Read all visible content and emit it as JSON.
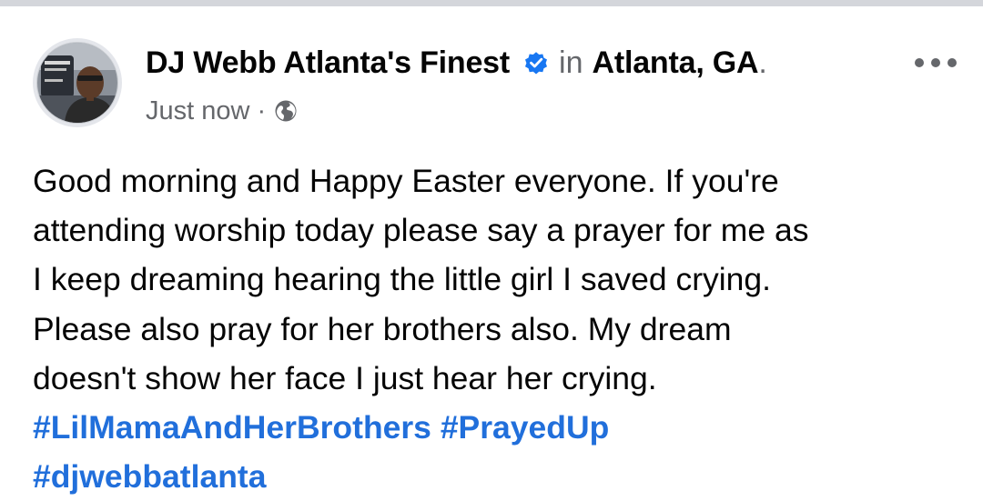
{
  "post": {
    "author": {
      "name": "DJ Webb Atlanta's Finest",
      "verified_icon": "verified-badge-icon"
    },
    "location_prefix": "in",
    "location": "Atlanta, GA",
    "location_suffix": ".",
    "timestamp": "Just now",
    "separator": "·",
    "audience_icon": "globe-icon",
    "more_options_icon": "more-horizontal-icon",
    "body_lines": [
      "Good morning and Happy Easter everyone. If you're",
      "attending worship today please say a prayer for me as",
      "I keep dreaming hearing the little girl I saved crying.",
      "Please also pray for her brothers also. My dream",
      "doesn't show her face I just hear her crying."
    ],
    "hashtags": [
      "#LilMamaAndHerBrothers",
      "#PrayedUp",
      "#djwebbatlanta"
    ],
    "colors": {
      "hashtag": "#216fdb",
      "verified": "#1877f2",
      "secondary_text": "#65676b",
      "primary_text": "#050505",
      "divider": "#d4d6db"
    }
  }
}
